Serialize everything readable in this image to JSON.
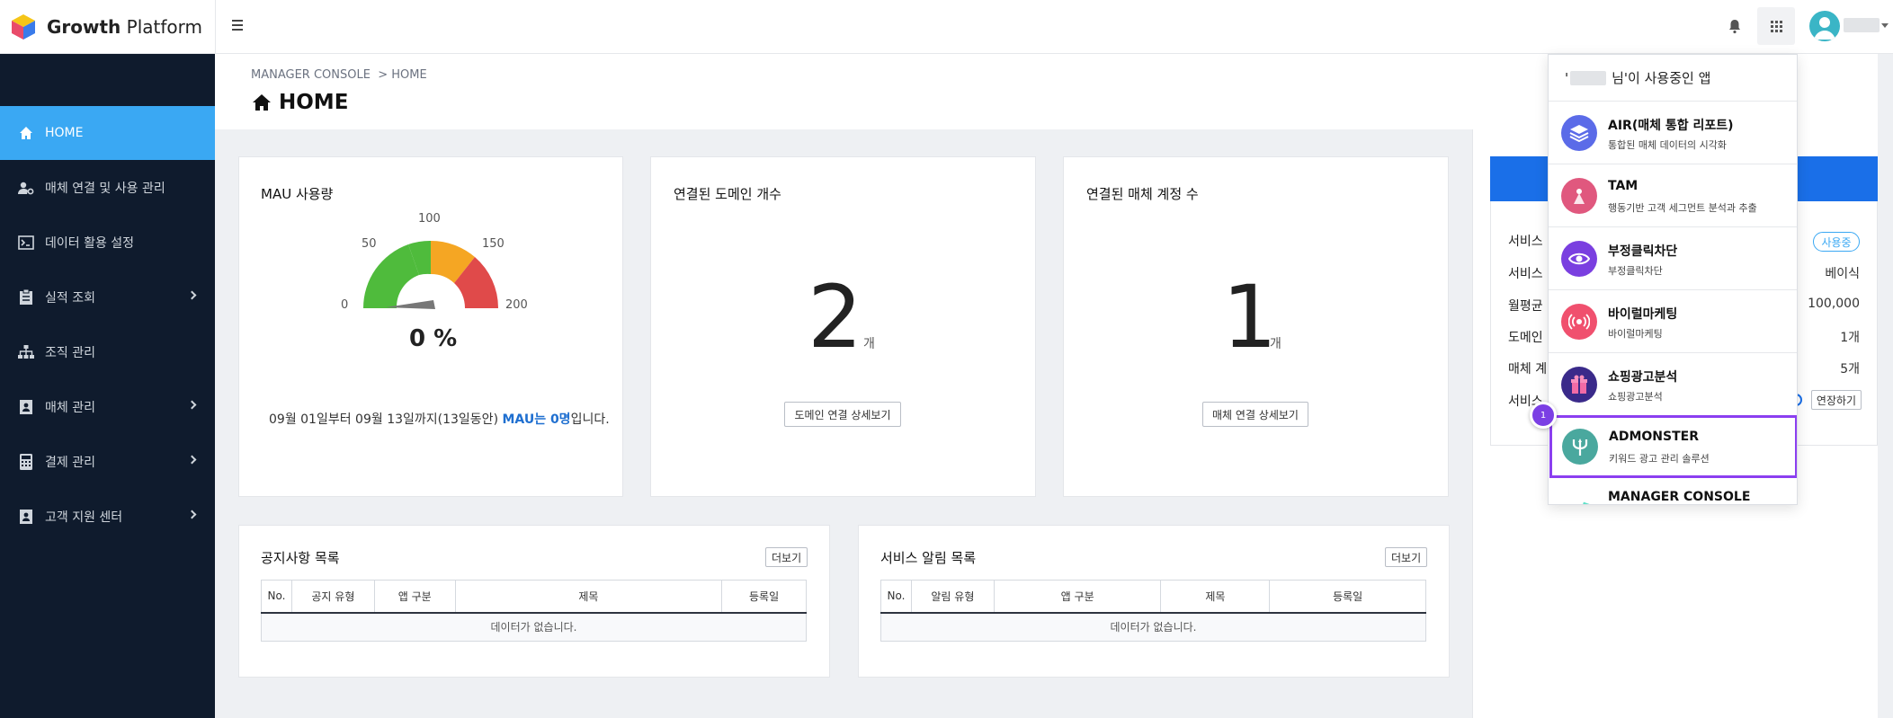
{
  "brand": {
    "logo_bold": "Growth",
    "logo_light": "Platform"
  },
  "breadcrumb": {
    "root": "MANAGER CONSOLE",
    "sep": ">",
    "current": "HOME"
  },
  "page_title": "HOME",
  "sidebar": {
    "items": [
      {
        "label": "HOME",
        "icon": "home-icon",
        "active": true,
        "has_children": false
      },
      {
        "label": "매체 연결 및 사용 관리",
        "icon": "user-gear-icon",
        "active": false,
        "has_children": false
      },
      {
        "label": "데이터 활용 설정",
        "icon": "terminal-icon",
        "active": false,
        "has_children": false
      },
      {
        "label": "실적 조회",
        "icon": "clipboard-icon",
        "active": false,
        "has_children": true
      },
      {
        "label": "조직 관리",
        "icon": "org-chart-icon",
        "active": false,
        "has_children": false
      },
      {
        "label": "매체 관리",
        "icon": "contact-card-icon",
        "active": false,
        "has_children": true
      },
      {
        "label": "결제 관리",
        "icon": "calculator-icon",
        "active": false,
        "has_children": true
      },
      {
        "label": "고객 지원 센터",
        "icon": "contact-card-icon",
        "active": false,
        "has_children": true
      }
    ]
  },
  "mau_card": {
    "title": "MAU 사용량",
    "gauge_labels": [
      "0",
      "50",
      "100",
      "150",
      "200"
    ],
    "percent": "0 %",
    "gauge_value": 0,
    "summary_prefix": "09월 01일부터 09월 13일까지(13일동안) ",
    "summary_highlight": "MAU는 0명",
    "summary_suffix": "입니다."
  },
  "domain_card": {
    "title": "연결된 도메인 개수",
    "value": "2",
    "unit": "개",
    "button": "도메인 연결 상세보기"
  },
  "account_card": {
    "title": "연결된 매체 계정 수",
    "value": "1",
    "unit": "개",
    "button": "매체 연결 상세보기"
  },
  "notice": {
    "title": "공지사항 목록",
    "more": "더보기",
    "columns": [
      "No.",
      "공지 유형",
      "앱 구분",
      "제목",
      "등록일"
    ],
    "empty": "데이터가 없습니다."
  },
  "alerts": {
    "title": "서비스 알림 목록",
    "more": "더보기",
    "columns": [
      "No.",
      "알림 유형",
      "앱 구분",
      "제목",
      "등록일"
    ],
    "empty": "데이터가 없습니다."
  },
  "service_panel": {
    "rows": [
      {
        "label": "서비스",
        "value": ""
      },
      {
        "label": "서비스",
        "value": "베이식"
      },
      {
        "label": "월평균",
        "value": "100,000"
      },
      {
        "label": "도메인",
        "value": "1개"
      },
      {
        "label": "매체 계",
        "value": "5개"
      },
      {
        "label": "서비스",
        "value": ""
      }
    ],
    "badge": "사용중",
    "extend_button": "연장하기"
  },
  "apps_dropdown": {
    "header_prefix": "'",
    "header_suffix": " 님'이 사용중인 앱",
    "apps": [
      {
        "name": "AIR(매체 통합 리포트)",
        "desc": "통합된 매체 데이터의 시각화",
        "icon": "layers-icon",
        "color": "#5b6be8"
      },
      {
        "name": "TAM",
        "desc": "행동기반 고객 세그먼트 분석과 추출",
        "icon": "people-icon",
        "color": "#e0587e"
      },
      {
        "name": "부정클릭차단",
        "desc": "부정클릭차단",
        "icon": "eye-icon",
        "color": "#7a3fe0"
      },
      {
        "name": "바이럴마케팅",
        "desc": "바이럴마케팅",
        "icon": "broadcast-icon",
        "color": "#f0506e"
      },
      {
        "name": "쇼핑광고분석",
        "desc": "쇼핑광고분석",
        "icon": "gift-icon",
        "color": "#3a2a8a"
      },
      {
        "name": "ADMONSTER",
        "desc": "키워드 광고 관리 솔루션",
        "icon": "trident-icon",
        "color": "#4aa89e",
        "selected": true
      },
      {
        "name": "MANAGER CONSOLE",
        "desc": "",
        "icon": "console-icon",
        "color": "#2ec4c4"
      }
    ],
    "step_badge": "1"
  },
  "colors": {
    "sidebar_bg": "#0f1b2d",
    "active": "#3aa8f3",
    "accent_blue": "#1a6fe8",
    "selected_border": "#8b3ff0"
  }
}
